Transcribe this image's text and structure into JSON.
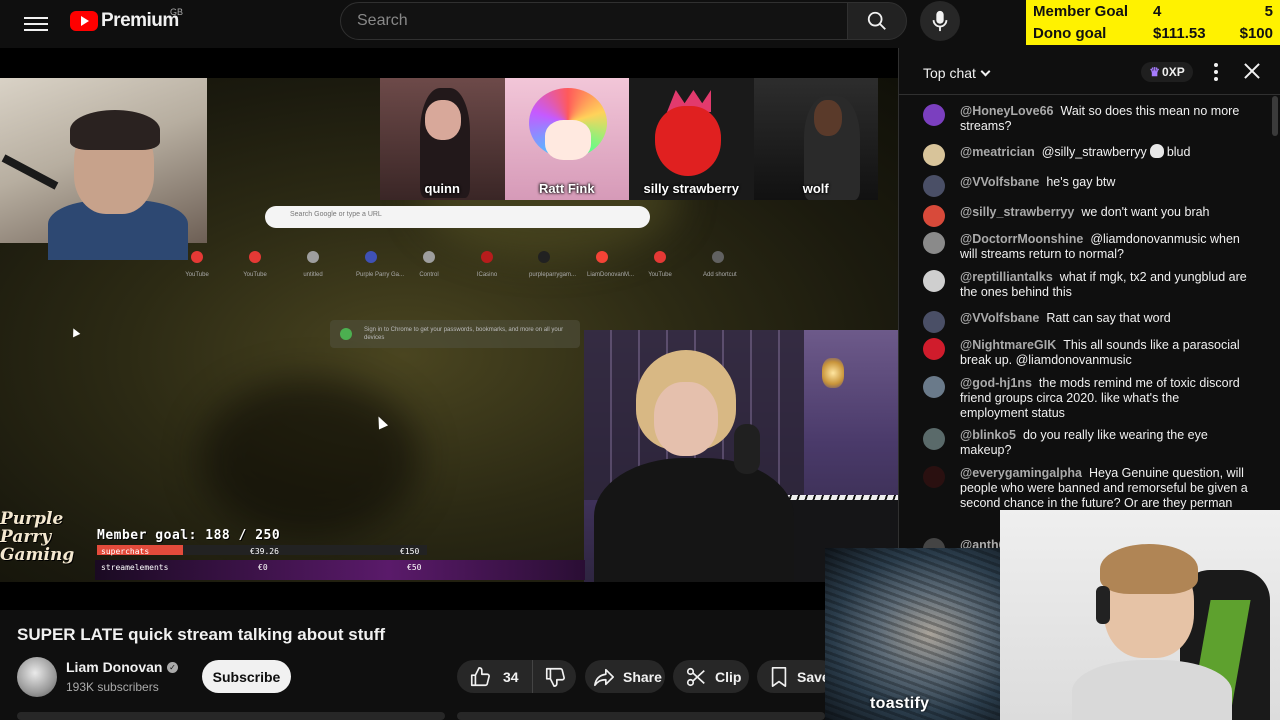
{
  "header": {
    "brand": "Premium",
    "region": "GB",
    "search_placeholder": "Search"
  },
  "goal_overlay": {
    "member_label": "Member Goal",
    "member_current": "4",
    "member_target": "5",
    "dono_label": "Dono goal",
    "dono_current": "$111.53",
    "dono_target": "$100"
  },
  "video": {
    "thumbnails": [
      {
        "label": "quinn"
      },
      {
        "label": "Ratt Fink"
      },
      {
        "label": "silly strawberry"
      },
      {
        "label": "wolf"
      }
    ],
    "browser_search_placeholder": "Search Google or type a URL",
    "shortcuts": [
      {
        "label": "YouTube",
        "color": "#e53935"
      },
      {
        "label": "YouTube",
        "color": "#e53935"
      },
      {
        "label": "untitled",
        "color": "#9e9e9e"
      },
      {
        "label": "Purple Parry Ga...",
        "color": "#3f51b5"
      },
      {
        "label": "Control",
        "color": "#9e9e9e"
      },
      {
        "label": "ICasino",
        "color": "#b71c1c"
      },
      {
        "label": "purpleparrygam...",
        "color": "#212121"
      },
      {
        "label": "LiamDonovanM...",
        "color": "#f44336"
      },
      {
        "label": "YouTube",
        "color": "#e53935"
      },
      {
        "label": "Add shortcut",
        "color": "#616161"
      }
    ],
    "chrome_signin_text": "Sign in to Chrome to get your passwords, bookmarks, and more on all your devices",
    "overlay_logo_lines": [
      "Purple",
      "Parry",
      "Gaming"
    ],
    "member_goal_text": "Member goal: 188 / 250",
    "goal_rows": [
      {
        "label": "superchats",
        "value": "€39.26",
        "target": "€150",
        "progress": 0.26
      },
      {
        "label": "streamelements",
        "value": "€0",
        "target": "€50",
        "progress": 0
      }
    ]
  },
  "title": "SUPER LATE quick stream talking about stuff",
  "channel": {
    "name": "Liam Donovan",
    "subscribers": "193K subscribers",
    "subscribe_label": "Subscribe"
  },
  "actions": {
    "like_count": "34",
    "share_label": "Share",
    "clip_label": "Clip",
    "save_label": "Save"
  },
  "chat": {
    "title": "Top chat",
    "xp": "0XP",
    "messages": [
      {
        "author": "@HoneyLove66",
        "text": "Wait so does this mean no more streams?",
        "color": "#7b3fbf"
      },
      {
        "author": "@meatrician",
        "text": "@silly_strawberryy",
        "suffix": "blud",
        "skull": true,
        "color": "#d8c49a"
      },
      {
        "author": "@VVolfsbane",
        "text": "he's gay btw",
        "color": "#4a4f66"
      },
      {
        "author": "@silly_strawberryy",
        "text": "we don't want you brah",
        "color": "#d84a3a"
      },
      {
        "author": "@DoctorrMoonshine",
        "text": "@liamdonovanmusic when will streams return to normal?",
        "color": "#8a8a8a"
      },
      {
        "author": "@reptilliantalks",
        "text": "what if mgk, tx2 and yungblud are the ones behind this",
        "color": "#cfcfcf"
      },
      {
        "author": "@VVolfsbane",
        "text": "Ratt can say that word",
        "color": "#4a4f66"
      },
      {
        "author": "@NightmareGIK",
        "text": "This all sounds like a parasocial break up. @liamdonovanmusic",
        "color": "#d01c2c"
      },
      {
        "author": "@god-hj1ns",
        "text": "the mods remind me of toxic discord friend groups circa 2020. like what's the employment status",
        "color": "#6a7a8a"
      },
      {
        "author": "@blinko5",
        "text": "do you really like wearing the eye makeup?",
        "color": "#5a6a6a"
      },
      {
        "author": "@everygamingalpha",
        "text": "Heya Genuine question, will people who were banned and remorseful be given a second chance in the future? Or are they perman",
        "color": "#2a1010"
      },
      {
        "author": "@anth6",
        "text": "",
        "color": "#444444"
      }
    ]
  },
  "corner_cam_label": "toastify"
}
